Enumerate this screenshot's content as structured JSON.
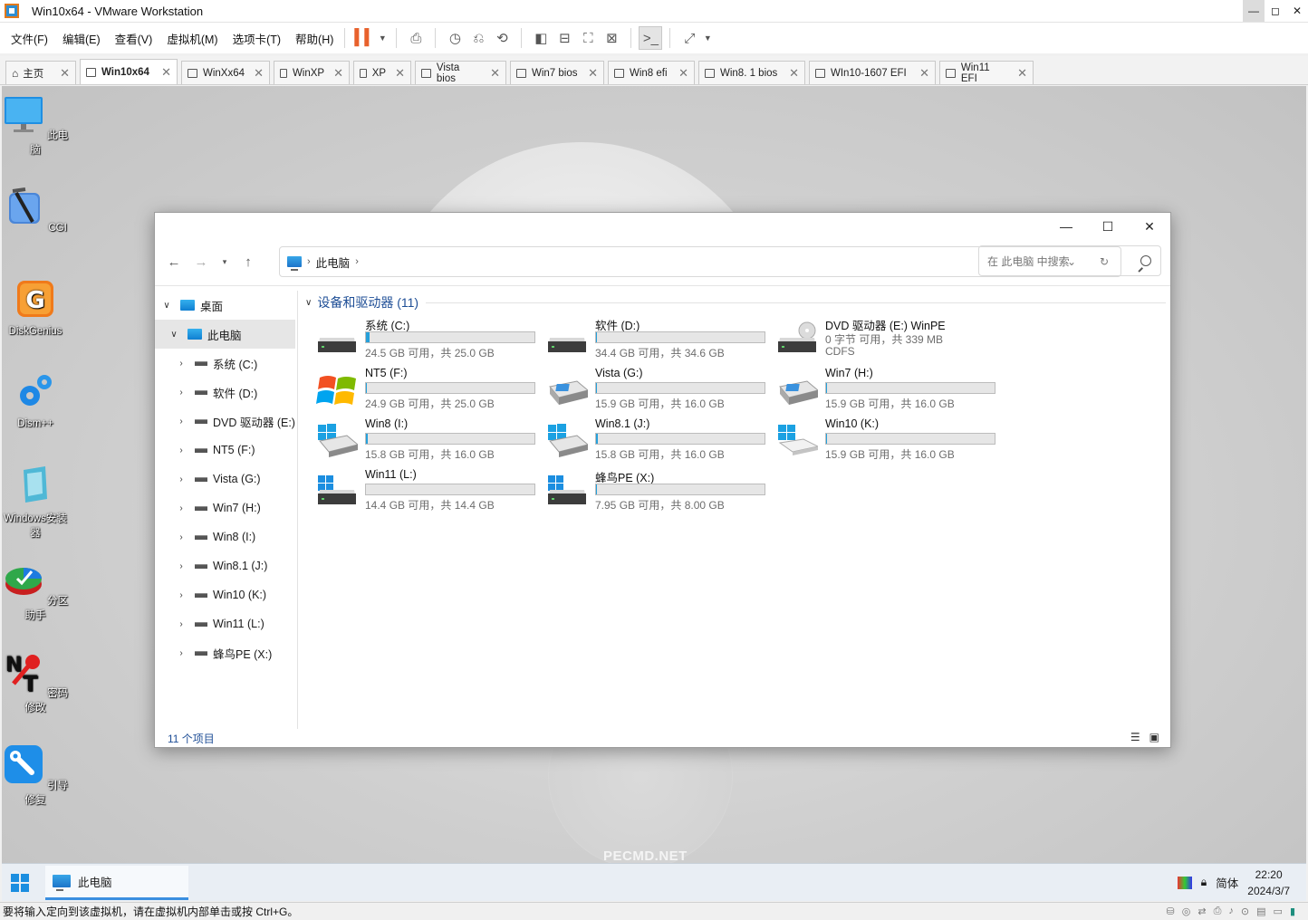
{
  "window": {
    "title": "Win10x64 - VMware Workstation"
  },
  "menu": [
    "文件(F)",
    "编辑(E)",
    "查看(V)",
    "虚拟机(M)",
    "选项卡(T)",
    "帮助(H)"
  ],
  "tabs": [
    {
      "label": "主页",
      "active": false
    },
    {
      "label": "Win10x64",
      "active": true
    },
    {
      "label": "WinXx64",
      "active": false
    },
    {
      "label": "WinXP",
      "active": false
    },
    {
      "label": "XP",
      "active": false
    },
    {
      "label": "Vista bios",
      "active": false
    },
    {
      "label": "Win7 bios",
      "active": false
    },
    {
      "label": "Win8 efi",
      "active": false
    },
    {
      "label": "Win8. 1 bios",
      "active": false
    },
    {
      "label": "WIn10-1607 EFI",
      "active": false
    },
    {
      "label": "Win11 EFI",
      "active": false
    }
  ],
  "desktop": {
    "icons": [
      "此电脑",
      "CGI",
      "DiskGenius",
      "Dism++",
      "Windows安装器",
      "分区助手",
      "密码修改",
      "引导修复"
    ],
    "watermark": "PECMD.NET"
  },
  "explorer": {
    "breadcrumb": "此电脑",
    "search_placeholder": "在 此电脑 中搜索",
    "tree": [
      {
        "label": "桌面",
        "level": 0,
        "expanded": true
      },
      {
        "label": "此电脑",
        "level": 1,
        "expanded": true,
        "selected": true
      },
      {
        "label": "系统 (C:)",
        "level": 2
      },
      {
        "label": "软件 (D:)",
        "level": 2
      },
      {
        "label": "DVD 驱动器 (E:)",
        "level": 2
      },
      {
        "label": "NT5 (F:)",
        "level": 2
      },
      {
        "label": "Vista (G:)",
        "level": 2
      },
      {
        "label": "Win7 (H:)",
        "level": 2
      },
      {
        "label": "Win8 (I:)",
        "level": 2
      },
      {
        "label": "Win8.1 (J:)",
        "level": 2
      },
      {
        "label": "Win10 (K:)",
        "level": 2
      },
      {
        "label": "Win11 (L:)",
        "level": 2
      },
      {
        "label": "蜂鸟PE (X:)",
        "level": 2
      }
    ],
    "group_title": "设备和驱动器 (11)",
    "drives": [
      {
        "name": "系统 (C:)",
        "info": "24.5 GB 可用，共 25.0 GB",
        "used": 0.02,
        "icon": "hdd"
      },
      {
        "name": "软件 (D:)",
        "info": "34.4 GB 可用，共 34.6 GB",
        "used": 0.006,
        "icon": "hdd"
      },
      {
        "name": "DVD 驱动器 (E:) WinPE",
        "info": "0 字节 可用，共 339 MB",
        "fs": "CDFS",
        "icon": "dvd"
      },
      {
        "name": "NT5 (F:)",
        "info": "24.9 GB 可用，共 25.0 GB",
        "used": 0.004,
        "icon": "xp"
      },
      {
        "name": "Vista (G:)",
        "info": "15.9 GB 可用，共 16.0 GB",
        "used": 0.006,
        "icon": "hdd-color"
      },
      {
        "name": "Win7 (H:)",
        "info": "15.9 GB 可用，共 16.0 GB",
        "used": 0.006,
        "icon": "hdd-color"
      },
      {
        "name": "Win8 (I:)",
        "info": "15.8 GB 可用，共 16.0 GB",
        "used": 0.012,
        "icon": "hdd-win"
      },
      {
        "name": "Win8.1 (J:)",
        "info": "15.8 GB 可用，共 16.0 GB",
        "used": 0.012,
        "icon": "hdd-win"
      },
      {
        "name": "Win10 (K:)",
        "info": "15.9 GB 可用，共 16.0 GB",
        "used": 0.006,
        "icon": "hdd-win-light"
      },
      {
        "name": "Win11 (L:)",
        "info": "14.4 GB 可用，共 14.4 GB",
        "used": 0.0,
        "icon": "hdd-win11"
      },
      {
        "name": "蜂鸟PE (X:)",
        "info": "7.95 GB 可用，共 8.00 GB",
        "used": 0.006,
        "icon": "hdd-win11"
      }
    ],
    "status": "11 个项目"
  },
  "taskbar": {
    "app": "此电脑",
    "ime": "简体",
    "time": "22:20",
    "date": "2024/3/7"
  },
  "vm_status": "要将输入定向到该虚拟机，请在虚拟机内部单击或按 Ctrl+G。"
}
